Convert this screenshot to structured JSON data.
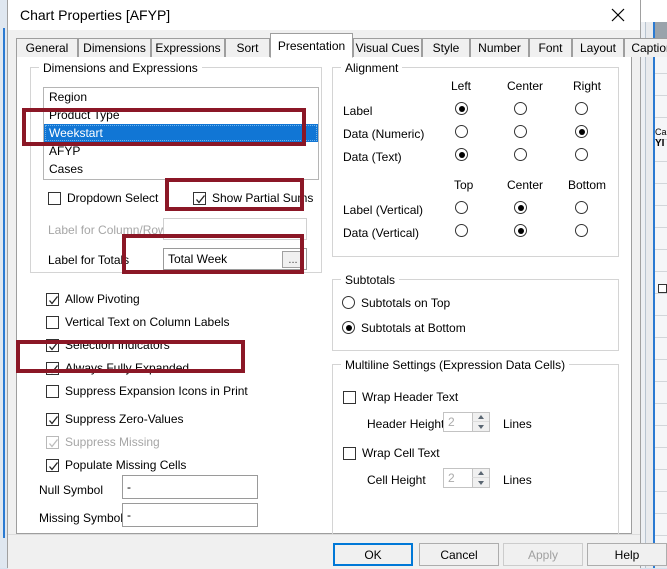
{
  "window": {
    "title": "Chart Properties [AFYP]",
    "close_icon": "close-icon"
  },
  "tabs": [
    {
      "label": "General",
      "selected": false
    },
    {
      "label": "Dimensions",
      "selected": false
    },
    {
      "label": "Expressions",
      "selected": false
    },
    {
      "label": "Sort",
      "selected": false
    },
    {
      "label": "Presentation",
      "selected": true
    },
    {
      "label": "Visual Cues",
      "selected": false
    },
    {
      "label": "Style",
      "selected": false
    },
    {
      "label": "Number",
      "selected": false
    },
    {
      "label": "Font",
      "selected": false
    },
    {
      "label": "Layout",
      "selected": false
    },
    {
      "label": "Caption",
      "selected": false
    }
  ],
  "dimensions_group": {
    "title": "Dimensions and Expressions",
    "list_items": [
      {
        "label": "Region",
        "selected": false
      },
      {
        "label": "Product Type",
        "selected": false
      },
      {
        "label": "Weekstart",
        "selected": true
      },
      {
        "label": "AFYP",
        "selected": false
      },
      {
        "label": "Cases",
        "selected": false
      }
    ],
    "dropdown_select": {
      "label": "Dropdown Select",
      "checked": false,
      "enabled": true
    },
    "show_partial_sums": {
      "label": "Show Partial Sums",
      "checked": true,
      "enabled": true
    },
    "label_for_column_row": {
      "label": "Label for Column/Row",
      "value": "",
      "enabled": false
    },
    "label_for_totals": {
      "label": "Label for Totals",
      "value": "Total Week",
      "enabled": true,
      "browse_button": "..."
    }
  },
  "options": [
    {
      "label": "Allow Pivoting",
      "checked": true,
      "enabled": true
    },
    {
      "label": "Vertical Text on Column Labels",
      "checked": false,
      "enabled": true
    },
    {
      "label": "Selection Indicators",
      "checked": true,
      "enabled": true
    },
    {
      "label": "Always Fully Expanded",
      "checked": true,
      "enabled": true
    },
    {
      "label": "Suppress Expansion Icons in Print",
      "checked": false,
      "enabled": true
    },
    {
      "label": "Suppress Zero-Values",
      "checked": true,
      "enabled": true
    },
    {
      "label": "Suppress Missing",
      "checked": true,
      "enabled": false
    },
    {
      "label": "Populate Missing Cells",
      "checked": true,
      "enabled": true
    }
  ],
  "symbols": {
    "null_symbol": {
      "label": "Null Symbol",
      "value": "-"
    },
    "missing_symbol": {
      "label": "Missing Symbol",
      "value": "-"
    }
  },
  "alignment": {
    "title": "Alignment",
    "horizontal_headers": [
      "Left",
      "Center",
      "Right"
    ],
    "horizontal_rows": [
      {
        "label": "Label",
        "selected": "Left"
      },
      {
        "label": "Data (Numeric)",
        "selected": "Right"
      },
      {
        "label": "Data (Text)",
        "selected": "Left"
      }
    ],
    "vertical_headers": [
      "Top",
      "Center",
      "Bottom"
    ],
    "vertical_rows": [
      {
        "label": "Label (Vertical)",
        "selected": "Center"
      },
      {
        "label": "Data (Vertical)",
        "selected": "Center"
      }
    ]
  },
  "subtotals": {
    "title": "Subtotals",
    "options": [
      {
        "label": "Subtotals on Top",
        "selected": false
      },
      {
        "label": "Subtotals at Bottom",
        "selected": true
      }
    ]
  },
  "multiline": {
    "title": "Multiline Settings (Expression Data Cells)",
    "wrap_header_text": {
      "label": "Wrap Header Text",
      "checked": false
    },
    "header_height": {
      "label": "Header Height",
      "value": "2",
      "units": "Lines",
      "enabled": false
    },
    "wrap_cell_text": {
      "label": "Wrap Cell Text",
      "checked": false
    },
    "cell_height": {
      "label": "Cell Height",
      "value": "2",
      "units": "Lines",
      "enabled": false
    }
  },
  "buttons": [
    {
      "label": "OK",
      "style": "default",
      "enabled": true
    },
    {
      "label": "Cancel",
      "style": "normal",
      "enabled": true
    },
    {
      "label": "Apply",
      "style": "disabled",
      "enabled": false
    },
    {
      "label": "Help",
      "style": "normal",
      "enabled": true
    }
  ],
  "annotations": {
    "color": "#8b1726",
    "boxes": [
      {
        "name": "weekstart-dimension-highlight"
      },
      {
        "name": "show-partial-sums-highlight"
      },
      {
        "name": "label-for-totals-highlight"
      },
      {
        "name": "always-fully-expanded-highlight"
      }
    ]
  },
  "background_window": {
    "partial_text_1": "Ca",
    "partial_text_2": "YI"
  }
}
